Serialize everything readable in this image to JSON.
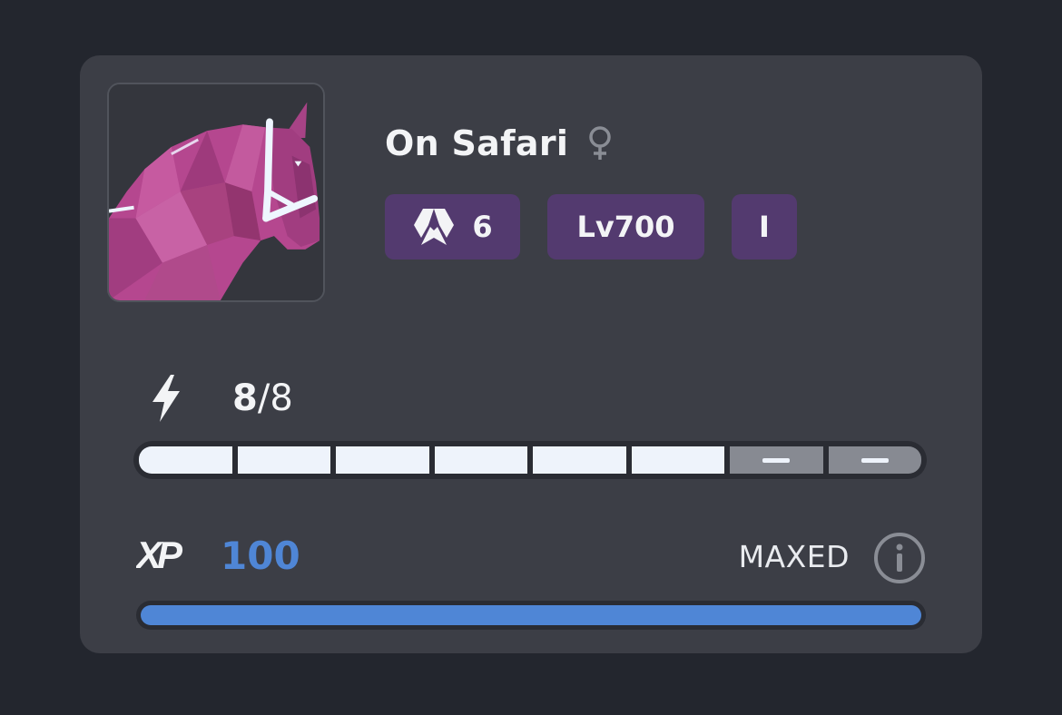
{
  "horse": {
    "name": "On Safari",
    "gender_icon": "female-symbol-icon",
    "portrait_icon": "horse-portrait-image",
    "badges": {
      "breed_icon": "zed-breed-icon",
      "breed_value": "6",
      "level": "Lv700",
      "generation": "I"
    }
  },
  "energy": {
    "icon": "lightning-bolt-icon",
    "current": "8",
    "separator": "/",
    "max": "8",
    "segments_total": 8,
    "segments_filled": 6
  },
  "xp": {
    "logo": "XP",
    "value": "100",
    "status": "MAXED",
    "info_icon": "info-icon",
    "progress": 1.0
  },
  "colors": {
    "background": "#23262e",
    "card": "#3c3e46",
    "badge": "#533a6f",
    "xp_accent": "#4f86d6",
    "horse_body": "#b5478f"
  }
}
